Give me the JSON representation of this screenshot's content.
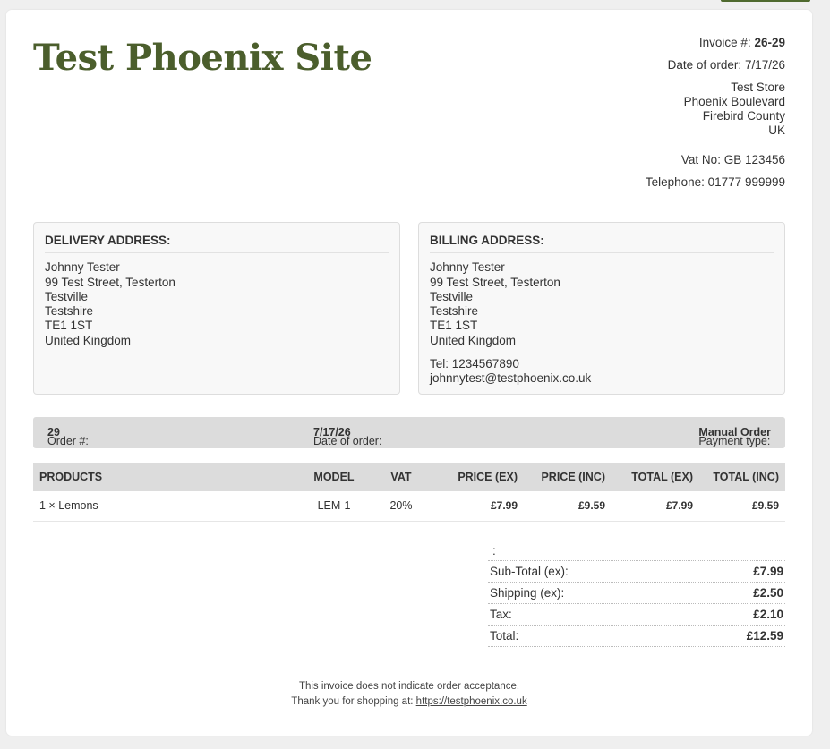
{
  "store": {
    "name": "Test Phoenix Site",
    "invoice_label": "Invoice #:",
    "invoice_no": "26-29",
    "date_label": "Date of order:",
    "date_value": "7/17/26",
    "address": [
      "Test Store",
      "Phoenix Boulevard",
      "Firebird County",
      "UK"
    ],
    "vat": "Vat No: GB 123456",
    "telephone": "Telephone: 01777 999999"
  },
  "delivery": {
    "heading": "DELIVERY ADDRESS:",
    "lines": [
      "Johnny Tester",
      "99 Test Street, Testerton",
      "Testville",
      "Testshire",
      "TE1 1ST",
      "United Kingdom"
    ]
  },
  "billing": {
    "heading": "BILLING ADDRESS:",
    "lines": [
      "Johnny Tester",
      "99 Test Street, Testerton",
      "Testville",
      "Testshire",
      "TE1 1ST",
      "United Kingdom"
    ],
    "tel": "Tel: 1234567890",
    "email": "johnnytest@testphoenix.co.uk"
  },
  "order": {
    "order_label": "Order #:",
    "order_no": "29",
    "date_label": "Date of order:",
    "date_value": "7/17/26",
    "payment_label": "Payment type:",
    "payment_value": "Manual Order"
  },
  "table": {
    "headers": [
      "PRODUCTS",
      "MODEL",
      "VAT",
      "PRICE (EX)",
      "PRICE (INC)",
      "TOTAL (EX)",
      "TOTAL (INC)"
    ],
    "rows": [
      [
        "1 × Lemons",
        "LEM-1",
        "20%",
        "£7.99",
        "£9.59",
        "£7.99",
        "£9.59"
      ]
    ]
  },
  "totals": {
    "first": ":",
    "subtotal_label": "Sub-Total (ex):",
    "subtotal_value": "£7.99",
    "shipping_label": "Shipping (ex):",
    "shipping_value": "£2.50",
    "tax_label": "Tax:",
    "tax_value": "£2.10",
    "total_label": "Total:",
    "total_value": "£12.59"
  },
  "footer": {
    "line1": "This invoice does not indicate order acceptance.",
    "line2_prefix": "Thank you for shopping at:",
    "link": "https://testphoenix.co.uk"
  },
  "colors": {
    "brand": "#4b5e2c",
    "bar": "#dcdcdc"
  }
}
